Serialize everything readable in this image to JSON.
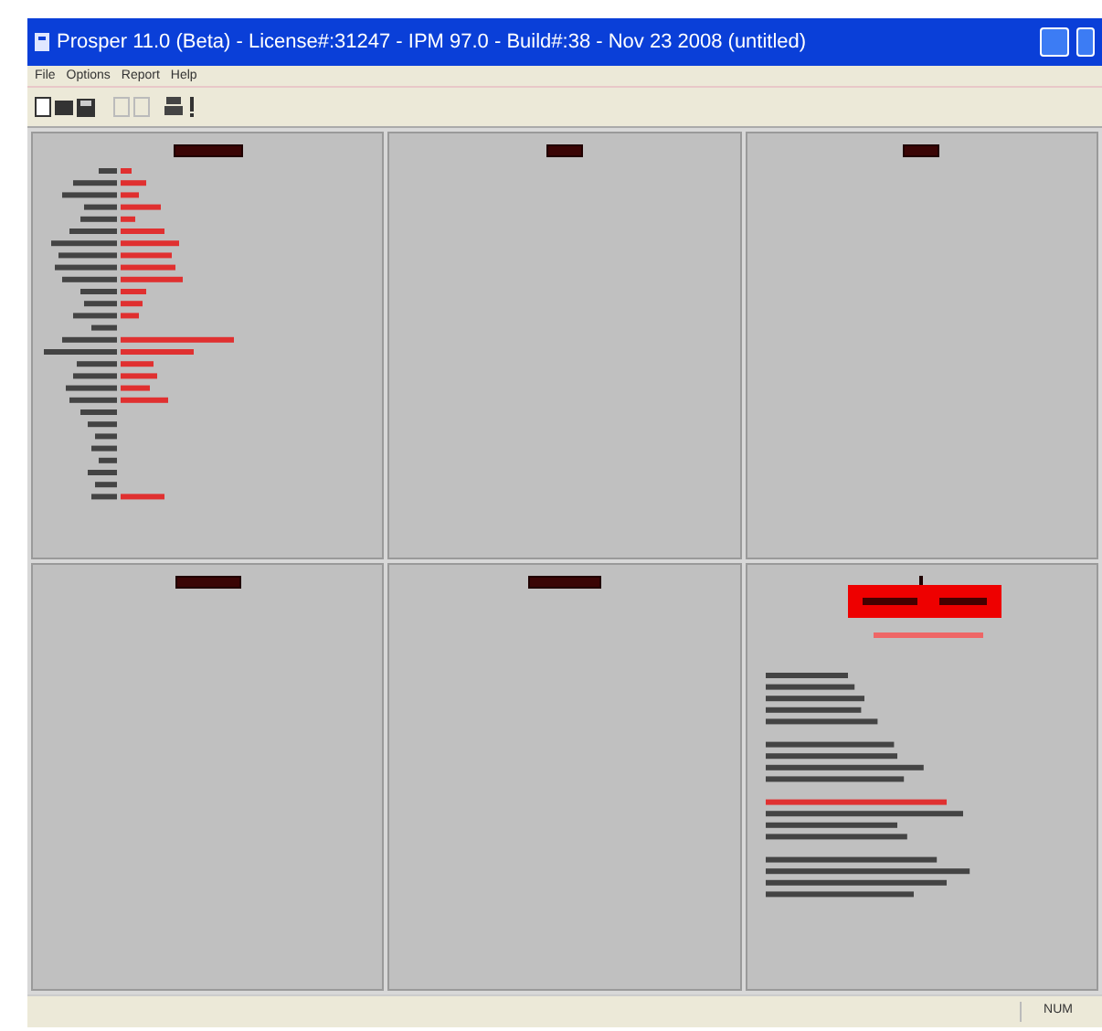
{
  "window": {
    "title": "Prosper 11.0 (Beta) - License#:31247 - IPM 97.0 - Build#:38 - Nov 23 2008 (untitled)"
  },
  "menu": [
    "File",
    "Options",
    "Report",
    "Help"
  ],
  "status_bar": {
    "indicator": "NUM"
  }
}
